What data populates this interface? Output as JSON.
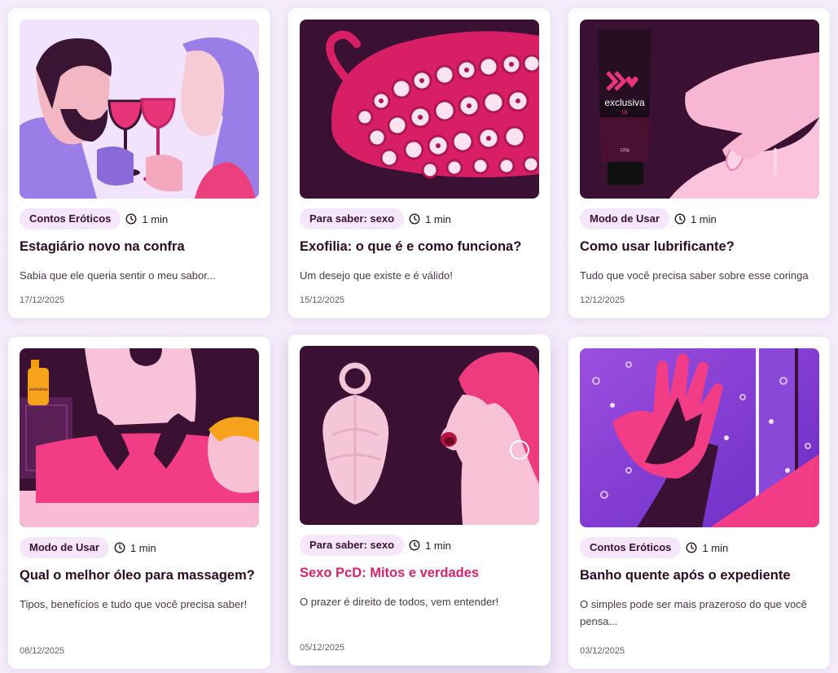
{
  "posts": [
    {
      "category": "Contos Eróticos",
      "read_time": "1 min",
      "title": "Estagiário novo na confra",
      "excerpt": "Sabia que ele queria sentir o meu sabor...",
      "date": "17/12/2025"
    },
    {
      "category": "Para saber: sexo",
      "read_time": "1 min",
      "title": "Exofilia: o que é e como funciona?",
      "excerpt": "Um desejo que existe e é válido!",
      "date": "15/12/2025"
    },
    {
      "category": "Modo de Usar",
      "read_time": "1 min",
      "title": "Como usar lubrificante?",
      "excerpt": "Tudo que você precisa saber sobre esse coringa",
      "date": "12/12/2025",
      "image_text": {
        "brand": "exclusiva",
        "variant": "LB",
        "weight": "120g"
      }
    },
    {
      "category": "Modo de Usar",
      "read_time": "1 min",
      "title": "Qual o melhor óleo para massagem?",
      "excerpt": "Tipos, benefícios e tudo que você precisa saber!",
      "date": "08/12/2025",
      "image_text": {
        "brand": "exclusiva"
      }
    },
    {
      "category": "Para saber: sexo",
      "read_time": "1 min",
      "title": "Sexo PcD: Mitos e verdades",
      "excerpt": "O prazer é direito de todos, vem entender!",
      "date": "05/12/2025"
    },
    {
      "category": "Contos Eróticos",
      "read_time": "1 min",
      "title": "Banho quente após o expediente",
      "excerpt": "O simples pode ser mais prazeroso do que você pensa...",
      "date": "03/12/2025"
    }
  ],
  "colors": {
    "page_bg": "#f4ecfb",
    "tag_bg": "#f6e6fb",
    "title": "#2a0d24",
    "title_hover": "#d6246e",
    "brand_pink": "#e8357a",
    "brand_dark": "#3a1033"
  },
  "icons": {
    "read_time": "clock-icon"
  }
}
